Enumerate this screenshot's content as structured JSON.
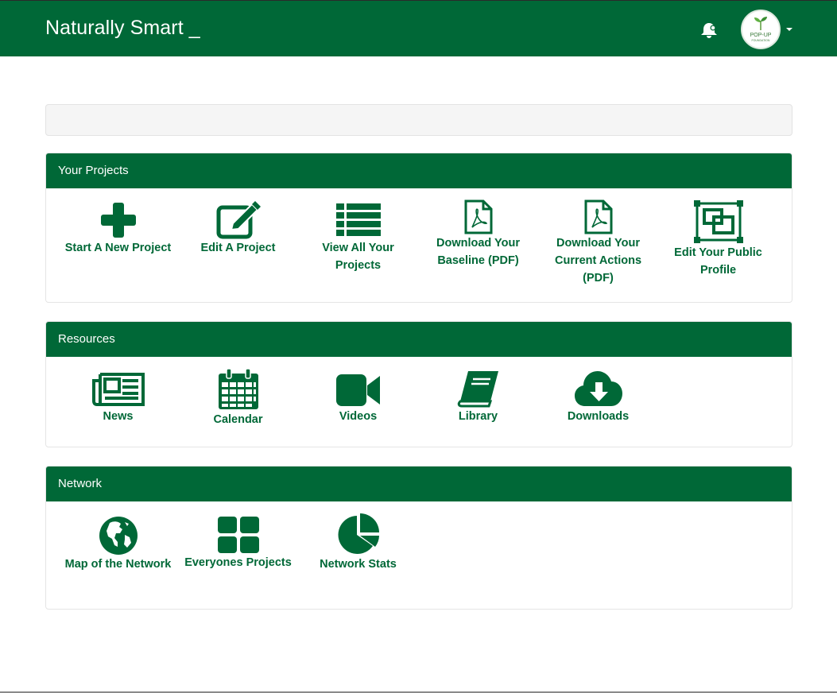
{
  "app": {
    "title": "Naturally Smart _"
  },
  "user": {
    "avatar_line1": "POP-UP",
    "avatar_line2": "FOUNDATION"
  },
  "colors": {
    "brand": "#006837",
    "notice_bg": "#f5f5f5"
  },
  "panels": [
    {
      "title": "Your Projects",
      "items": [
        {
          "label": "Start A New Project",
          "icon": "plus-icon"
        },
        {
          "label": "Edit A Project",
          "icon": "edit-icon"
        },
        {
          "label": "View All Your Projects",
          "icon": "list-icon"
        },
        {
          "label": "Download Your Baseline (PDF)",
          "icon": "pdf-icon"
        },
        {
          "label": "Download Your Current Actions (PDF)",
          "icon": "pdf-icon"
        },
        {
          "label": "Edit Your Public Profile",
          "icon": "object-group-icon"
        }
      ]
    },
    {
      "title": "Resources",
      "items": [
        {
          "label": "News",
          "icon": "newspaper-icon"
        },
        {
          "label": "Calendar",
          "icon": "calendar-icon"
        },
        {
          "label": "Videos",
          "icon": "video-camera-icon"
        },
        {
          "label": "Library",
          "icon": "book-icon"
        },
        {
          "label": "Downloads",
          "icon": "cloud-download-icon"
        }
      ]
    },
    {
      "title": "Network",
      "items": [
        {
          "label": "Map of the Network",
          "icon": "globe-icon"
        },
        {
          "label": "Everyones Projects",
          "icon": "grid-icon"
        },
        {
          "label": "Network Stats",
          "icon": "pie-chart-icon"
        }
      ]
    }
  ]
}
